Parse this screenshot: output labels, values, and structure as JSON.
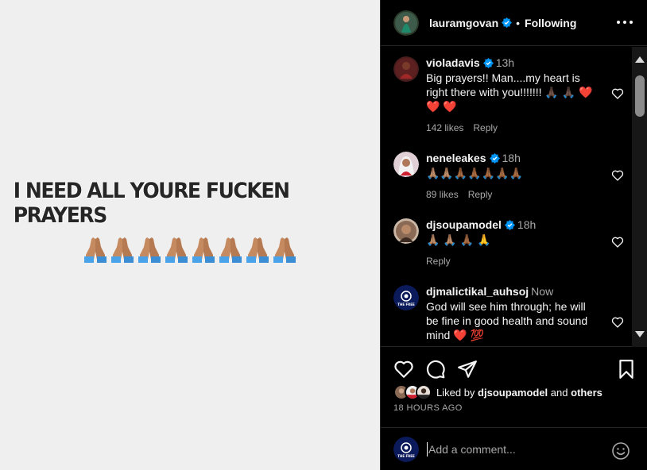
{
  "post": {
    "text": "I NEED ALL YOURE FUCKEN PRAYERS",
    "emoji_count": 8,
    "emoji": "folded-hands"
  },
  "header": {
    "username": "lauramgovan",
    "separator": "•",
    "follow_status": "Following",
    "more_icon": "more-horizontal-icon"
  },
  "comments": [
    {
      "username": "violadavis",
      "verified": true,
      "time": "13h",
      "text": "Big prayers!! Man....my heart is right there with you!!!!!!! 🙏🏿 🙏🏿 ❤️ ❤️ ❤️",
      "likes": "142 likes",
      "reply": "Reply"
    },
    {
      "username": "neneleakes",
      "verified": true,
      "time": "18h",
      "text": "🙏🏽🙏🏽🙏🏾🙏🏾🙏🏾🙏🏾🙏🏾",
      "likes": "89 likes",
      "reply": "Reply"
    },
    {
      "username": "djsoupamodel",
      "verified": true,
      "time": "18h",
      "text": "🙏🏽 🙏🏽 🙏🏾 🙏",
      "likes": "",
      "reply": "Reply"
    },
    {
      "username": "djmalictikal_auhsoj",
      "verified": false,
      "time": "Now",
      "text": "God will see him through; he will be fine in good health and sound mind ❤️ 💯",
      "likes": "",
      "reply": ""
    }
  ],
  "actions": {
    "like_icon": "heart-icon",
    "comment_icon": "comment-icon",
    "share_icon": "send-icon",
    "save_icon": "bookmark-icon"
  },
  "likes": {
    "prefix": "Liked by",
    "user": "djsoupamodel",
    "joiner": "and",
    "others": "others"
  },
  "time_ago": "18 HOURS AGO",
  "add_comment": {
    "placeholder": "Add a comment..."
  },
  "avatar_badge": "THE FREE",
  "colors": {
    "background": "#000000",
    "post_bg": "#efefef",
    "text": "#f5f5f5",
    "muted": "#a8a8a8",
    "verified": "#0095f6",
    "heart_red": "#ed4956"
  }
}
